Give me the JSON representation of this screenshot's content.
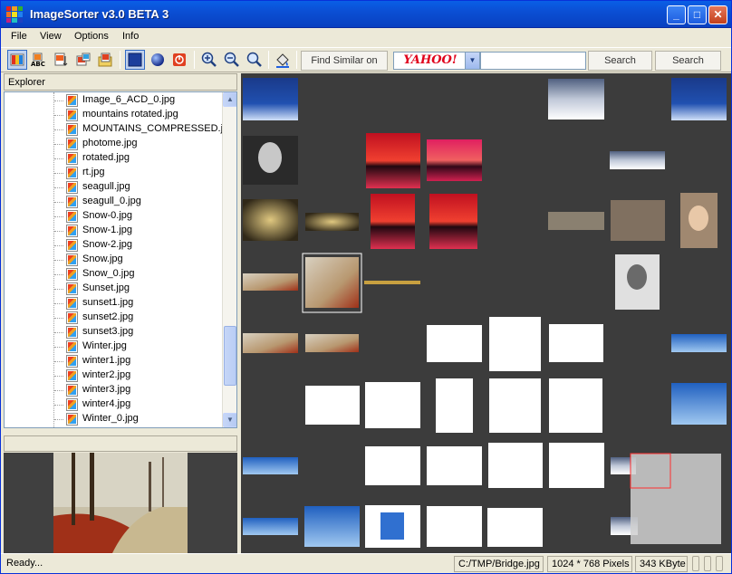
{
  "window": {
    "title": "ImageSorter v3.0 BETA 3",
    "minimize_glyph": "_",
    "maximize_glyph": "□",
    "close_glyph": "✕",
    "titlebar_color": "#0b4fd4"
  },
  "menu": [
    "File",
    "View",
    "Options",
    "Info"
  ],
  "toolbar": {
    "icons": [
      "sort-color-icon",
      "sort-name-icon",
      "sort-date-icon",
      "sort-size-icon",
      "sort-folder-icon",
      "plane-view-icon",
      "sphere-view-icon",
      "stop-icon",
      "zoom-in-icon",
      "zoom-out-icon",
      "zoom-fit-icon",
      "paint-bucket-icon"
    ],
    "find_similar_label": "Find Similar on Disk",
    "search_engine": "YAHOO!",
    "search_value": "",
    "search_label": "Search",
    "search_similar_label": "Search Similar"
  },
  "explorer": {
    "header": "Explorer",
    "files": [
      "Image_6_ACD_0.jpg",
      "mountains rotated.jpg",
      "MOUNTAINS_COMPRESSED.j...",
      "photome.jpg",
      "rotated.jpg",
      "rt.jpg",
      "seagull.jpg",
      "seagull_0.jpg",
      "Snow-0.jpg",
      "Snow-1.jpg",
      "Snow-2.jpg",
      "Snow.jpg",
      "Snow_0.jpg",
      "Sunset.jpg",
      "sunset1.jpg",
      "sunset2.jpg",
      "sunset3.jpg",
      "Winter.jpg",
      "winter1.jpg",
      "winter2.jpg",
      "winter3.jpg",
      "winter4.jpg",
      "Winter_0.jpg"
    ]
  },
  "status": {
    "text": "Ready...",
    "path": "C:/TMP/Bridge.jpg",
    "dimensions": "1024 * 768 Pixels",
    "size": "343 KByte"
  },
  "colors": {
    "canvas_bg": "#3c3c3c",
    "selection_border": "#ffffff",
    "yahoo_red": "#e0001b"
  }
}
